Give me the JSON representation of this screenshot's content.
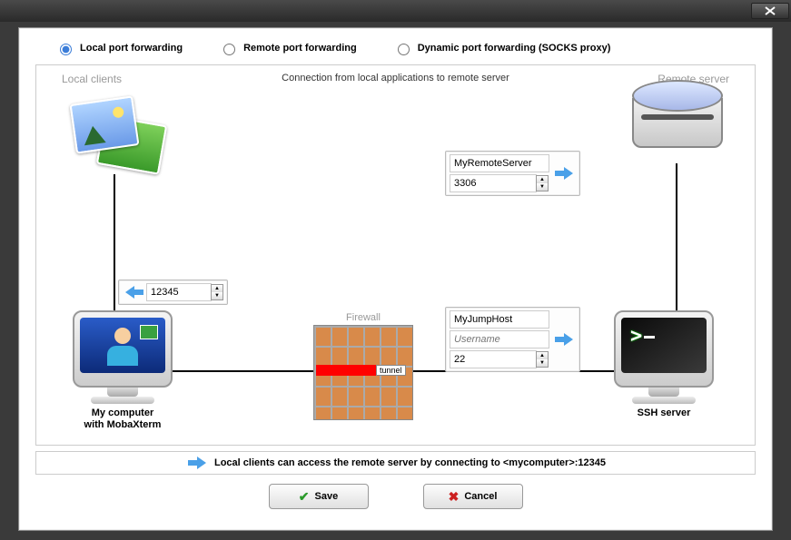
{
  "radios": {
    "local": "Local port forwarding",
    "remote": "Remote port forwarding",
    "dynamic": "Dynamic port forwarding (SOCKS proxy)",
    "selected": "local"
  },
  "labels": {
    "local_clients": "Local clients",
    "remote_server": "Remote server",
    "firewall": "Firewall",
    "tunnel": "tunnel",
    "my_computer_line1": "My computer",
    "my_computer_line2": "with MobaXterm",
    "ssh_server": "SSH server"
  },
  "caption": "Connection from local applications to remote server",
  "fields": {
    "local_port": "12345",
    "remote_host": "MyRemoteServer",
    "remote_port": "3306",
    "ssh_host": "MyJumpHost",
    "ssh_user_placeholder": "Username",
    "ssh_port": "22"
  },
  "help_text": "Local clients can access the remote server by connecting to <mycomputer>:12345",
  "buttons": {
    "save": "Save",
    "cancel": "Cancel"
  }
}
